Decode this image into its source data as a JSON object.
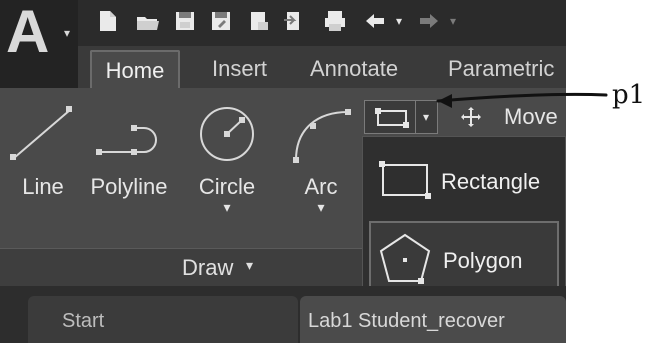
{
  "app": {
    "logo_text": "A",
    "quick_access_icons": [
      "new-file-icon",
      "open-folder-icon",
      "save-icon",
      "save-as-icon",
      "publish-icon",
      "share-icon",
      "plot-printer-icon",
      "undo-icon",
      "undo-dropdown-icon",
      "redo-icon",
      "redo-dropdown-icon"
    ]
  },
  "ribbon": {
    "tabs": [
      {
        "label": "Home",
        "active": true
      },
      {
        "label": "Insert",
        "active": false
      },
      {
        "label": "Annotate",
        "active": false
      },
      {
        "label": "Parametric",
        "active": false
      }
    ],
    "draw_panel": {
      "tools": [
        {
          "label": "Line",
          "icon": "line-icon",
          "has_dropdown": false
        },
        {
          "label": "Polyline",
          "icon": "polyline-icon",
          "has_dropdown": false
        },
        {
          "label": "Circle",
          "icon": "circle-icon",
          "has_dropdown": true
        },
        {
          "label": "Arc",
          "icon": "arc-icon",
          "has_dropdown": true
        }
      ],
      "footer_label": "Draw",
      "rectangle_split_button": {
        "icon": "rectangle-icon",
        "caret_icon": "chevron-down-icon"
      }
    },
    "modify_panel": {
      "move": {
        "label": "Move",
        "icon": "move-icon"
      }
    }
  },
  "dropdown": {
    "items": [
      {
        "label": "Rectangle",
        "icon": "rectangle-icon",
        "highlighted": false
      },
      {
        "label": "Polygon",
        "icon": "polygon-icon",
        "highlighted": true
      }
    ]
  },
  "document_tabs": [
    {
      "label": "Start",
      "active": false
    },
    {
      "label": "Lab1 Student_recover",
      "active": true
    }
  ],
  "callout": {
    "label": "p1"
  },
  "colors": {
    "app_bg": "#393939",
    "ribbon_bg": "#4a4a4a",
    "dropdown_bg": "#2f2f2f",
    "text": "#e6e6e6"
  }
}
